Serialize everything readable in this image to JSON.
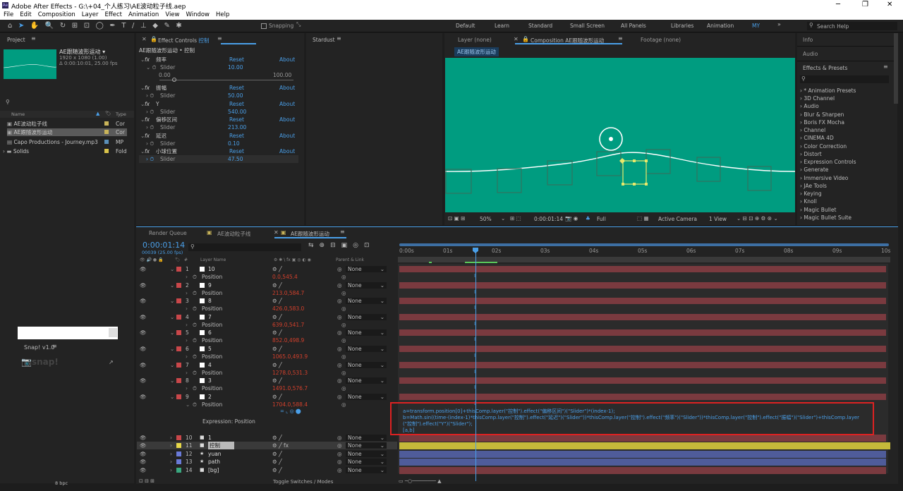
{
  "title": "Adobe After Effects - G:\\+04_个人练习\\AE波动粒子线.aep",
  "menu": [
    "File",
    "Edit",
    "Composition",
    "Layer",
    "Effect",
    "Animation",
    "View",
    "Window",
    "Help"
  ],
  "snapping": "Snapping",
  "workspaces": [
    "Default",
    "Learn",
    "Standard",
    "Small Screen",
    "All Panels",
    "Libraries",
    "Animation",
    "MY"
  ],
  "search_help": "Search Help",
  "project": {
    "tab": "Project",
    "comp_name": "AE跟随波形运动 ▾",
    "comp_size": "1920 x 1080 (1.00)",
    "comp_dur": "Δ 0:00:10:01, 25.00 fps",
    "col_name": "Name",
    "col_type": "Type",
    "items": [
      {
        "name": "AE波动粒子线",
        "type": "Cor"
      },
      {
        "name": "AE跟随波形运动",
        "type": "Cor"
      },
      {
        "name": "Capo Productions - Journey.mp3",
        "type": "MP"
      },
      {
        "name": "Solids",
        "type": "Fold"
      }
    ]
  },
  "snap": {
    "title": "Snap! v1.0",
    "logo": "snap!"
  },
  "bpc": "8 bpc",
  "effect_controls": {
    "tab": "Effect Controls",
    "tab_name": "控制",
    "header": "AE跟随波形运动 • 控制",
    "reset": "Reset",
    "about": "About",
    "slider": "Slider",
    "min": "0.00",
    "max": "100.00",
    "effects": [
      {
        "name": "频率",
        "value": "10.00"
      },
      {
        "name": "振幅",
        "value": "50.00"
      },
      {
        "name": "Y",
        "value": "540.00"
      },
      {
        "name": "偏移区间",
        "value": "213.00"
      },
      {
        "name": "延迟",
        "value": "0.10"
      },
      {
        "name": "小球位置",
        "value": "47.50"
      }
    ]
  },
  "stardust": "Stardust",
  "viewer": {
    "layer_tab": "Layer (none)",
    "comp_tab": "Composition AE跟随波形运动",
    "footage_tab": "Footage (none)",
    "comp_btn": "AE跟随波形运动",
    "zoom": "50%",
    "timecode": "0:00:01:14",
    "quality": "Full",
    "camera": "Active Camera",
    "view": "1 View"
  },
  "right": {
    "info": "Info",
    "audio": "Audio",
    "effects_presets": "Effects & Presets",
    "search_placeholder": "",
    "list": [
      "* Animation Presets",
      "3D Channel",
      "Audio",
      "Blur & Sharpen",
      "Boris FX Mocha",
      "Channel",
      "CINEMA 4D",
      "Color Correction",
      "Distort",
      "Expression Controls",
      "Generate",
      "Immersive Video",
      "JAe Tools",
      "Keying",
      "Knoll",
      "Magic Bullet",
      "Magic Bullet Suite"
    ]
  },
  "timeline": {
    "tabs": [
      "Render Queue",
      "AE波动粒子线",
      "AE跟随波形运动"
    ],
    "timecode": "0:00:01:14",
    "frames": "00039 (25.00 fps)",
    "col_layer": "Layer Name",
    "col_parent": "Parent & Link",
    "none": "None",
    "position": "Position",
    "ticks": [
      "0:00s",
      "01s",
      "02s",
      "03s",
      "04s",
      "05s",
      "06s",
      "07s",
      "08s",
      "09s",
      "10s"
    ],
    "layers": [
      {
        "n": "1",
        "name": "10",
        "pos": "0.0,545.4"
      },
      {
        "n": "2",
        "name": "9",
        "pos": "213.0,584.7"
      },
      {
        "n": "3",
        "name": "8",
        "pos": "426.0,583.0"
      },
      {
        "n": "4",
        "name": "7",
        "pos": "639.0,541.7"
      },
      {
        "n": "5",
        "name": "6",
        "pos": "852.0,498.9"
      },
      {
        "n": "6",
        "name": "5",
        "pos": "1065.0,493.9"
      },
      {
        "n": "7",
        "name": "4",
        "pos": "1278.0,531.3"
      },
      {
        "n": "8",
        "name": "3",
        "pos": "1491.0,576.7"
      },
      {
        "n": "9",
        "name": "2",
        "pos": "1704.0,588.4"
      }
    ],
    "expr_label": "Expression: Position",
    "expr": [
      "a=transform.position[0]+thisComp.layer(\"控制\").effect(\"偏移区间\")(\"Slider\")*(index-1);",
      "b=Math.sin((time-(index-1)*thisComp.layer(\"控制\").effect(\"延迟\")(\"Slider\"))*thisComp.layer(\"控制\").effect(\"频率\")(\"Slider\"))*thisComp.layer(\"控制\").effect(\"振幅\")(\"Slider\")+thisComp.layer",
      "(\"控制\").effect(\"Y\")(\"Slider\");",
      "[a,b]"
    ],
    "bottom_layers": [
      {
        "n": "10",
        "name": "1"
      },
      {
        "n": "11",
        "name": "控制"
      },
      {
        "n": "12",
        "name": "yuan"
      },
      {
        "n": "13",
        "name": "path"
      },
      {
        "n": "14",
        "name": "[bg]"
      }
    ],
    "toggle": "Toggle Switches / Modes"
  }
}
